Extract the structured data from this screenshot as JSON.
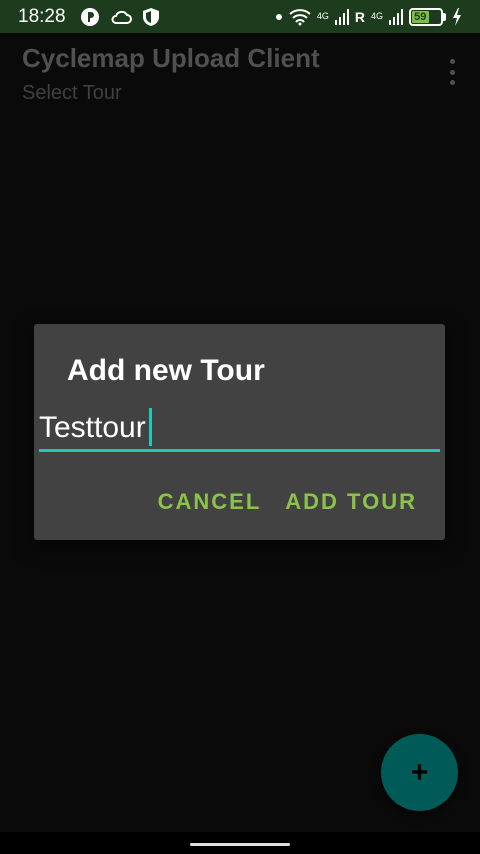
{
  "status_bar": {
    "time": "18:28",
    "left_icons": [
      "pinterest-like-icon",
      "cloud-icon",
      "shield-icon"
    ],
    "right_icons": [
      "dot-icon",
      "wifi-icon",
      "signal-4g-icon",
      "roaming-icon",
      "signal-4g-icon",
      "battery-icon",
      "charging-icon"
    ],
    "network_1": "4G",
    "roaming": "R",
    "network_2": "4G",
    "battery_level": "59",
    "battery_percent": 59
  },
  "app_bar": {
    "title": "Cyclemap Upload Client",
    "subtitle": "Select Tour"
  },
  "dialog": {
    "title": "Add new Tour",
    "input_value": "Testtour",
    "cancel_label": "CANCEL",
    "confirm_label": "ADD TOUR"
  },
  "fab": {
    "icon": "plus-icon",
    "symbol": "+"
  },
  "colors": {
    "status_bar_bg": "#1d3b1d",
    "accent": "#26c6b8",
    "button_text": "#8bc34a",
    "dialog_bg": "#424242",
    "fab_bg": "#005a57"
  }
}
